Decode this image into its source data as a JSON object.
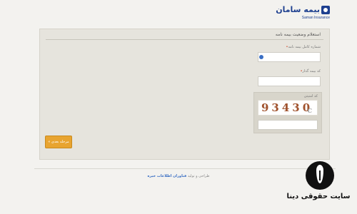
{
  "header": {
    "logo_fa": "بیمه سامان",
    "logo_en": "Saman Insurance"
  },
  "form": {
    "title": "استعلام وضعیت بیمه نامه",
    "policy_number_label": "شماره کامل بیمه نامه",
    "policy_number_value": "",
    "national_code_label": "کد بیمه گذار",
    "national_code_value": "",
    "captcha_label": "کد امنیتی",
    "captcha_text": "93430",
    "captcha_value": "",
    "next_button": "مرحله بعدی »"
  },
  "footer": {
    "prefix": "طراحی و تولید",
    "link": "فناوران اطلاعات خبره"
  },
  "watermark": {
    "text": "سایت حقوقی دینا"
  },
  "colors": {
    "brand_blue": "#1d3f8f",
    "button_orange": "#e8a430",
    "required_red": "#d04020"
  }
}
